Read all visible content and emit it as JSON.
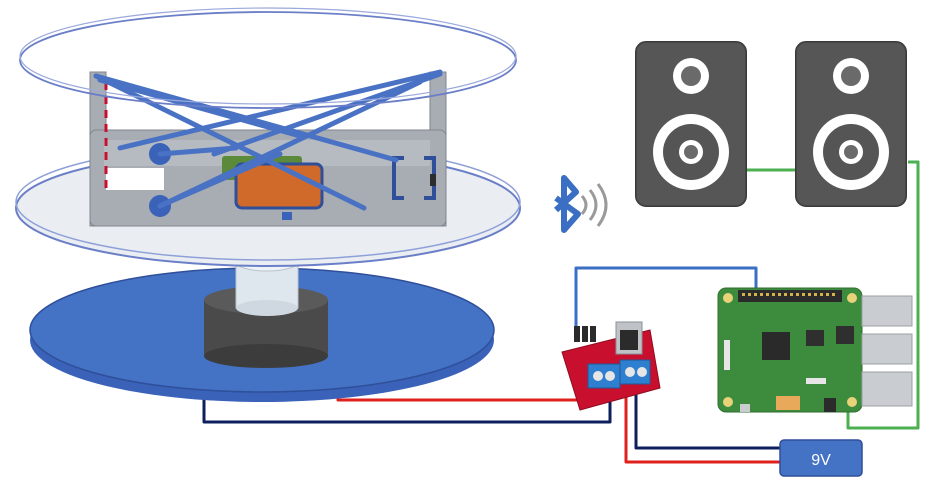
{
  "battery": {
    "label": "9V"
  },
  "colors": {
    "wire_red": "#e0201c",
    "wire_navy": "#0d1f5c",
    "wire_blue": "#3a6fc4",
    "wire_green": "#4caf50",
    "base_blue": "#4472c4",
    "driver_board": "#c8102e",
    "pi_board": "#3d8b3d",
    "speaker_body": "#555555",
    "motor_gray": "#4a4a4a",
    "battery_fill": "#4472c4"
  },
  "icons": [
    "bluetooth-icon",
    "speaker-icon",
    "raspberry-pi-icon",
    "motor-driver-icon",
    "battery-icon",
    "candle-icon",
    "motor-icon"
  ]
}
